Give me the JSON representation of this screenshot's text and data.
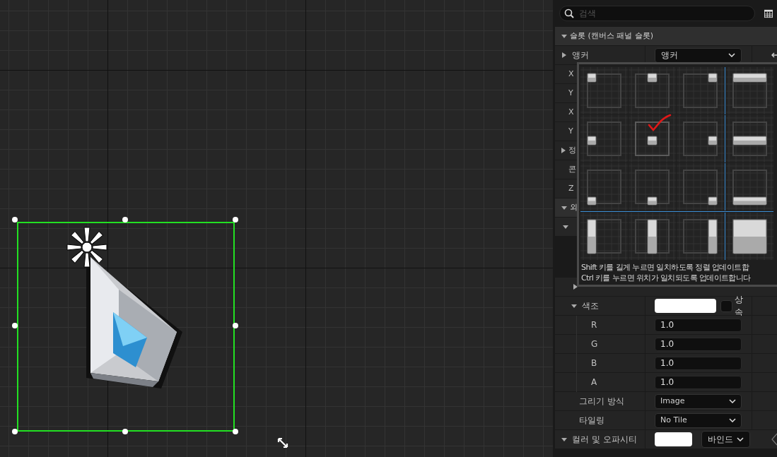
{
  "canvas": {
    "selection": {
      "selected": true
    }
  },
  "search": {
    "placeholder": "검색"
  },
  "rows": [
    {
      "kind": "section",
      "label": "슬롯 (캔버스 패널 슬롯)",
      "expanded": true
    },
    {
      "kind": "dropdown",
      "label": "앵커",
      "expanded": false,
      "value": "앵커"
    },
    {
      "kind": "property",
      "label": "X"
    },
    {
      "kind": "property",
      "label": "Y"
    },
    {
      "kind": "property",
      "label": "X"
    },
    {
      "kind": "property",
      "label": "Y"
    },
    {
      "kind": "group",
      "label": "정",
      "expanded": false
    },
    {
      "kind": "property",
      "label": "콘"
    },
    {
      "kind": "property",
      "label": "Z"
    },
    {
      "kind": "section",
      "label": "외",
      "expanded": true
    },
    {
      "kind": "subsection",
      "expanded": true
    },
    {
      "kind": "covered"
    },
    {
      "kind": "covered-group",
      "expanded": false
    },
    {
      "kind": "color",
      "label": "색조",
      "expanded": true,
      "inherit": {
        "label": "상속",
        "checked": false
      }
    },
    {
      "kind": "channel",
      "label": "R",
      "value": "1.0"
    },
    {
      "kind": "channel",
      "label": "G",
      "value": "1.0"
    },
    {
      "kind": "channel",
      "label": "B",
      "value": "1.0"
    },
    {
      "kind": "channel",
      "label": "A",
      "value": "1.0"
    },
    {
      "kind": "select",
      "label": "그리기 방식",
      "value": "Image"
    },
    {
      "kind": "select",
      "label": "타일링",
      "value": "No Tile"
    },
    {
      "kind": "opacity",
      "label": "컬러 및 오파시티",
      "expanded": true,
      "button": "바인드"
    }
  ],
  "anchor_popup": {
    "options": [
      {
        "kind": "top-left",
        "hovered": false
      },
      {
        "kind": "top-center",
        "hovered": false
      },
      {
        "kind": "top-right",
        "hovered": false
      },
      {
        "kind": "top-stretch",
        "hovered": false
      },
      {
        "kind": "center-left",
        "hovered": false
      },
      {
        "kind": "center-center",
        "hovered": true
      },
      {
        "kind": "center-right",
        "hovered": false
      },
      {
        "kind": "center-stretch",
        "hovered": false
      },
      {
        "kind": "bottom-left",
        "hovered": false
      },
      {
        "kind": "bottom-center",
        "hovered": false
      },
      {
        "kind": "bottom-right",
        "hovered": false
      },
      {
        "kind": "bottom-stretch",
        "hovered": false
      },
      {
        "kind": "stretch-left",
        "hovered": false
      },
      {
        "kind": "stretch-center",
        "hovered": false
      },
      {
        "kind": "stretch-right",
        "hovered": false
      },
      {
        "kind": "stretch-stretch",
        "hovered": false
      }
    ],
    "hints": [
      "Shift 키를 길게 누르면 일치하도록 정렬 업데이트합",
      "Ctrl 키를 누르면 위치가 일치되도록 업데이트합니다"
    ]
  }
}
